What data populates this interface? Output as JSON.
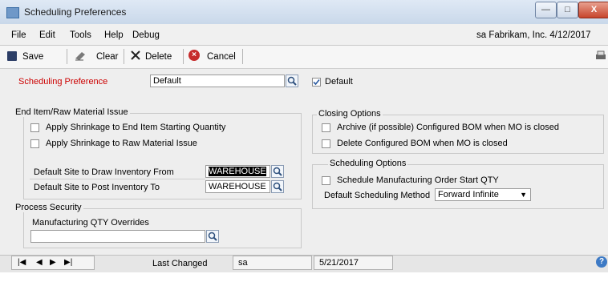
{
  "window": {
    "title": "Scheduling Preferences",
    "minimize": "—",
    "maximize": "□",
    "close": "X"
  },
  "menu": {
    "items": [
      "File",
      "Edit",
      "Tools",
      "Help",
      "Debug"
    ],
    "company": "sa  Fabrikam, Inc. 4/12/2017"
  },
  "toolbar": {
    "save": "Save",
    "clear": "Clear",
    "delete": "Delete",
    "cancel": "Cancel"
  },
  "form": {
    "scheduling_preference_label": "Scheduling Preference",
    "scheduling_preference_value": "Default",
    "default_checkbox_label": "Default",
    "default_checked": true,
    "end_item": {
      "title": "End Item/Raw Material Issue",
      "apply_end_item": "Apply Shrinkage to End Item Starting Quantity",
      "apply_raw": "Apply Shrinkage to Raw Material Issue",
      "draw_label": "Default Site to Draw Inventory From",
      "draw_value": "WAREHOUSE",
      "post_label": "Default Site to Post Inventory To",
      "post_value": "WAREHOUSE"
    },
    "process_security": {
      "title": "Process Security",
      "overrides_label": "Manufacturing QTY Overrides",
      "overrides_value": ""
    },
    "closing": {
      "title": "Closing Options",
      "archive": "Archive (if possible) Configured BOM when MO is closed",
      "delete": "Delete Configured BOM when MO is closed"
    },
    "scheduling": {
      "title": "Scheduling Options",
      "schedule_start": "Schedule Manufacturing Order Start QTY",
      "method_label": "Default Scheduling Method",
      "method_value": "Forward Infinite"
    }
  },
  "status": {
    "nav": [
      "|◀",
      "◀",
      "▶",
      "▶|"
    ],
    "last_changed_label": "Last Changed",
    "user": "sa",
    "date": "5/21/2017"
  },
  "colors": {
    "required_label": "#cc0000",
    "accent": "#3b6ea5"
  }
}
